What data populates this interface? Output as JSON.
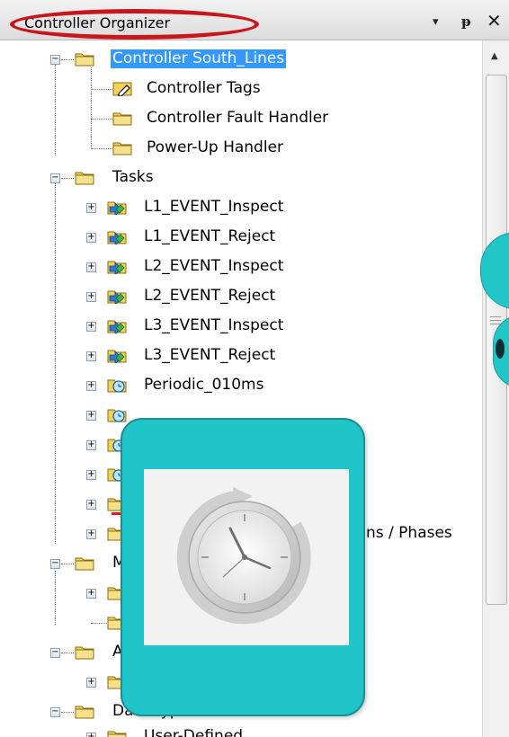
{
  "panel": {
    "title": "Controller Organizer",
    "buttons": {
      "dropdown": "▾",
      "pin": "ᵽ",
      "close": "✕"
    }
  },
  "tree": {
    "controller": "Controller South_Lines",
    "controller_tags": "Controller Tags",
    "fault_handler": "Controller Fault Handler",
    "powerup_handler": "Power-Up Handler",
    "tasks": "Tasks",
    "task_items": [
      "L1_EVENT_Inspect",
      "L1_EVENT_Reject",
      "L2_EVENT_Inspect",
      "L2_EVENT_Reject",
      "L3_EVENT_Inspect",
      "L3_EVENT_Reject",
      "Periodic_010ms"
    ],
    "phases_fragment": "ns / Phases",
    "partial_m": "M",
    "partial_a": "A",
    "data_types": "Data Types",
    "user_defined": "User-Defined"
  },
  "colors": {
    "accent": "#21c6c9",
    "selection": "#3399ff",
    "highlight": "#c8161d"
  },
  "icons": {
    "folder": "folder-icon",
    "tags": "tags-icon",
    "event_task": "event-task-icon",
    "periodic_task": "periodic-task-icon",
    "clock": "clock-icon"
  }
}
